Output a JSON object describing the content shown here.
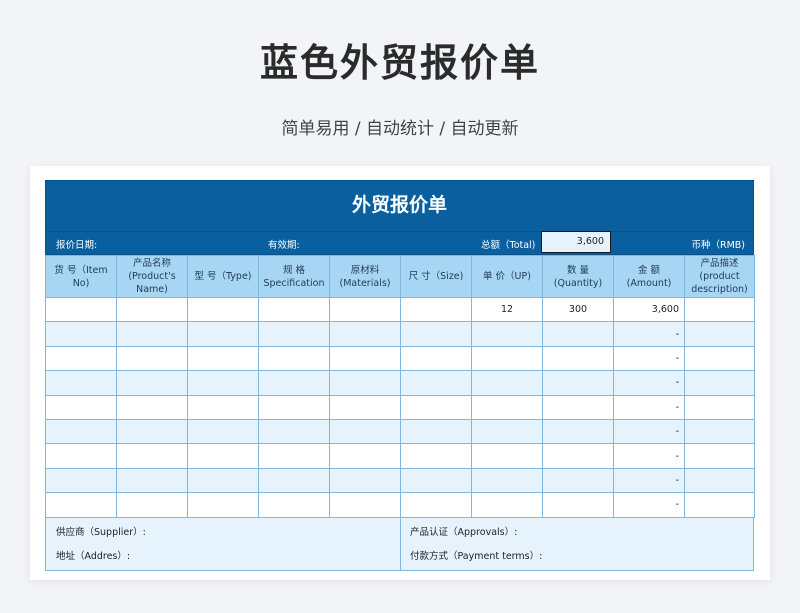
{
  "page": {
    "title": "蓝色外贸报价单",
    "subtitle": "简单易用 / 自动统计 / 自动更新"
  },
  "sheet": {
    "title": "外贸报价单",
    "info": {
      "quote_date_label": "报价日期:",
      "valid_label": "有效期:",
      "total_label": "总额（Total)",
      "total_value": "3,600",
      "currency_label": "币种（RMB)"
    },
    "columns": [
      [
        "货  号（Item",
        "No)"
      ],
      [
        "产品名称",
        "(Product's",
        "Name)"
      ],
      [
        "型  号（Type)"
      ],
      [
        "规  格",
        "Specification"
      ],
      [
        "原材料",
        "(Materials)"
      ],
      [
        "尺  寸（Size)"
      ],
      [
        "单  价（UP)"
      ],
      [
        "数  量",
        "(Quantity)"
      ],
      [
        "金  额",
        "(Amount)"
      ],
      [
        "产品描述",
        "(product",
        "description)"
      ]
    ],
    "rows": [
      [
        "",
        "",
        "",
        "",
        "",
        "",
        "12",
        "300",
        "3,600",
        ""
      ],
      [
        "",
        "",
        "",
        "",
        "",
        "",
        "",
        "",
        "-",
        ""
      ],
      [
        "",
        "",
        "",
        "",
        "",
        "",
        "",
        "",
        "-",
        ""
      ],
      [
        "",
        "",
        "",
        "",
        "",
        "",
        "",
        "",
        "-",
        ""
      ],
      [
        "",
        "",
        "",
        "",
        "",
        "",
        "",
        "",
        "-",
        ""
      ],
      [
        "",
        "",
        "",
        "",
        "",
        "",
        "",
        "",
        "-",
        ""
      ],
      [
        "",
        "",
        "",
        "",
        "",
        "",
        "",
        "",
        "-",
        ""
      ],
      [
        "",
        "",
        "",
        "",
        "",
        "",
        "",
        "",
        "-",
        ""
      ],
      [
        "",
        "",
        "",
        "",
        "",
        "",
        "",
        "",
        "-",
        ""
      ]
    ],
    "footer": {
      "supplier_label": "供应商（Supplier）:",
      "address_label": "地址（Addres）:",
      "approvals_label": "产品认证（Approvals）:",
      "payment_label": "付款方式（Payment terms）:"
    }
  }
}
